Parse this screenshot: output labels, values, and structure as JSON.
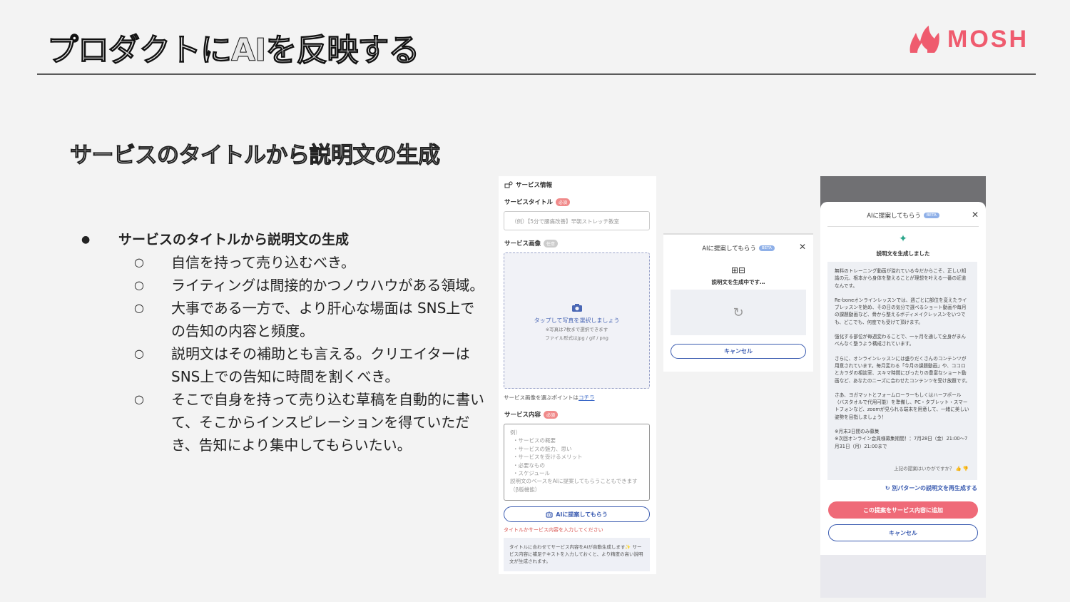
{
  "slide": {
    "title": "プロダクトにAIを反映する",
    "logo_text": "MOSH",
    "subtitle": "サービスのタイトルから説明文の生成",
    "bullet_main": "サービスのタイトルから説明文の生成",
    "bullet_dot": "●",
    "sub_marker": "○",
    "sub_bullets": [
      "自信を持って売り込むべき。",
      "ライティングは間接的かつノウハウがある領域。",
      "大事である一方で、より肝心な場面は SNS上での告知の内容と頻度。",
      "説明文はその補助とも言える。クリエイターはSNS上での告知に時間を割くべき。",
      "そこで自身を持って売り込む草稿を自動的に書いて、そこからインスピレーションを得ていただき、告知により集中してもらいたい。"
    ]
  },
  "form": {
    "section_title": "サービス情報",
    "title_label": "サービスタイトル",
    "required_badge": "必須",
    "optional_badge": "任意",
    "title_placeholder": "（例）【5分で腰痛改善】早朝ストレッチ教室",
    "image_label": "サービス画像",
    "upload_text": "タップして写真を選択しましょう",
    "upload_note1": "※写真は7枚まで選択できます",
    "upload_note2": "ファイル形式はjpg / gif / png",
    "image_point": "サービス画像を選ぶポイントは",
    "image_point_link": "コチラ",
    "content_label": "サービス内容",
    "content_placeholder": [
      "例）",
      "・サービスの概要",
      "・サービスの魅力、思い",
      "・サービスを受けるメリット",
      "・必要なもの",
      "・スケジュール",
      "説明文のベースをAIに提案してもらうこともできます（β版機能）"
    ],
    "ai_button": "AIに提案してもらう",
    "warning": "タイトルかサービス内容を入力してください",
    "note": "タイトルに合わせてサービス内容をAIが自動生成します✨ サービス内容に補足テキストを入力しておくと、より精度の高い説明文が生成されます。"
  },
  "loading_modal": {
    "title": "AIに提案してもらう",
    "beta": "BETA",
    "close": "✕",
    "icons": "⊞⊟",
    "generating": "説明文を生成中です…",
    "spinner": "↻",
    "cancel": "キャンセル"
  },
  "result_modal": {
    "title": "AIに提案してもらう",
    "beta": "BETA",
    "close": "✕",
    "sparkle": "✦",
    "done": "説明文を生成しました",
    "paragraphs": [
      "無料のトレーニング動画が溢れている今だからこそ、正しい知識の元、根本から身体を整えることが理想を叶える一番の近道なんです。",
      "Re-boneオンラインレッスンでは、週ごとに部位を変えたライブレッスンを始め、その日の気分で選べるショート動画や毎月の課題動画など、骨から整えるボディメイクレッスンをいつでも、どこでも、何度でも受けて頂けます。",
      "強化する部位が毎週変わることで、一ヶ月を通して全身がまんべんなく整うよう構成されています。",
      "さらに、オンラインレッスンには盛りだくさんのコンテンツが用意されています。毎月変わる「今月の課題動画」や、ココロとカラダの相談室、スキマ時間にぴったりの豊富なショート動画など、あなたのニーズに合わせたコンテンツを受け放題です。",
      "さあ、ヨガマットとフォームローラーもしくはハーフポール（バスタオルで代用可能）を準備し、PC・タブレット・スマートフォンなど、zoomが見られる端末を用意して、一緒に美しい姿勢を目指しましょう！",
      "※月末3日間のみ募集\n※次回オンライン会員様募集期間！：7月28日（金）21:00〜7月31日（月）21:00まで"
    ],
    "feedback": "上記の提案はいかがですか？ 👍 👎",
    "regenerate": "↻ 別パターンの説明文を再生成する",
    "add_button": "この提案をサービス内容に追加",
    "cancel": "キャンセル"
  }
}
